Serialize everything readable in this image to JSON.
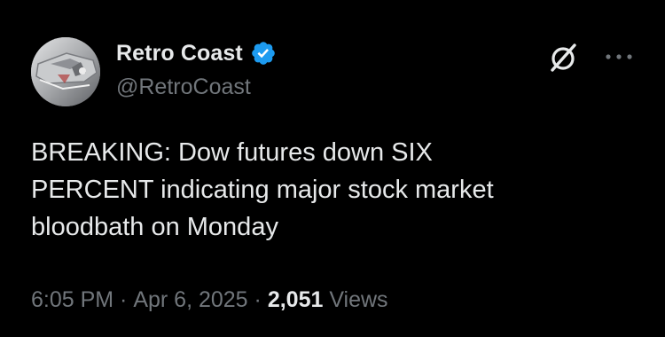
{
  "author": {
    "display_name": "Retro Coast",
    "handle": "@RetroCoast",
    "verified": true,
    "avatar_icon": "car-chrome-avatar",
    "verified_color": "#1d9bf0"
  },
  "header_icons": {
    "grok": "grok-icon",
    "more": "more-icon"
  },
  "tweet": {
    "text": "BREAKING: Dow futures down SIX\nPERCENT indicating major stock market\nbloodbath on Monday"
  },
  "meta": {
    "time": "6:05 PM",
    "separator1": " · ",
    "date": "Apr 6, 2025",
    "separator2": " · ",
    "views_count": "2,051",
    "views_label": " Views"
  },
  "colors": {
    "background": "#000000",
    "primary_text": "#e7e9ea",
    "secondary_text": "#71767b"
  }
}
